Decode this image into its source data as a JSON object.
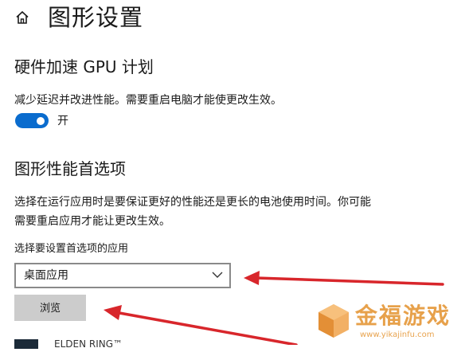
{
  "header": {
    "title": "图形设置",
    "home_icon": "home-icon"
  },
  "gpu_scheduling": {
    "title": "硬件加速 GPU 计划",
    "description": "减少延迟并改进性能。需要重启电脑才能使更改生效。",
    "toggle_on": true,
    "toggle_label": "开"
  },
  "graphics_preference": {
    "title": "图形性能首选项",
    "description": "选择在运行应用时是要保证更好的性能还是更长的电池使用时间。你可能需要重启应用才能让更改生效。",
    "select_label": "选择要设置首选项的应用",
    "select_value": "桌面应用",
    "browse_label": "浏览"
  },
  "app_list": [
    {
      "name": "ELDEN RING™"
    }
  ],
  "watermark": {
    "title": "金福游戏",
    "url": "www.yikajinfu.com"
  },
  "colors": {
    "accent": "#0a6cce",
    "arrow": "#d8262b",
    "watermark": "#e69a3c"
  }
}
